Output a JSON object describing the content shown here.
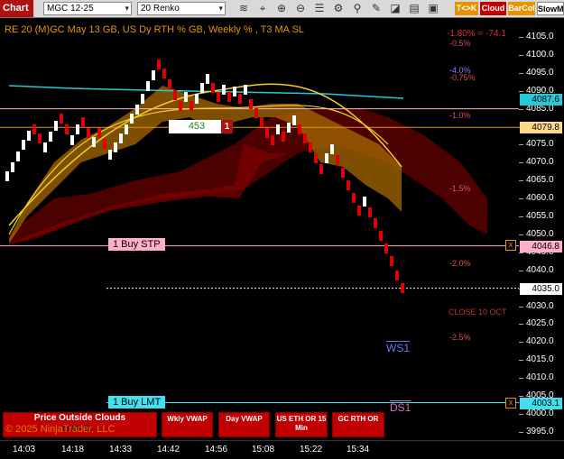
{
  "toolbar": {
    "tab": "Chart",
    "instrument": "MGC 12-25",
    "interval": "20 Renko",
    "buttons": [
      {
        "label": "T<>K",
        "color": "#e59400"
      },
      {
        "label": "Cloud",
        "color": "#c00000"
      },
      {
        "label": "BarCol",
        "color": "#e59400"
      },
      {
        "label": "SlowM",
        "color": "#ffffff"
      }
    ],
    "icons": [
      "bars-icon",
      "crosshair-icon",
      "zoom-in-icon",
      "zoom-out-icon",
      "properties-icon",
      "strategy-icon",
      "indicator-icon",
      "pencil-icon",
      "data-box-icon"
    ]
  },
  "chart": {
    "title": "RE 20  (M)GC May 13 GB, US Dy RTH % GB, Weekly % , T3 MA SL",
    "pnl": "-1.80% = -74.1",
    "bars_label": "453",
    "bars_count": "1",
    "colors": {
      "up": "#ffffff",
      "down": "#e00000",
      "yellow": "#f5d020",
      "orange": "#e59400",
      "cyan": "#28c8d8",
      "pink": "#ff9ec2",
      "dark_red": "#5a0000",
      "buy_lmt": "#40e0f0"
    }
  },
  "pct_labels": [
    {
      "text": "-0.5%",
      "price": 4103.0,
      "color": "#e05050"
    },
    {
      "text": "-4.0%",
      "price": 4095.5,
      "color": "#8080ff"
    },
    {
      "text": "-0.75%",
      "price": 4093.4,
      "color": "#e05050"
    },
    {
      "text": "-1.0%",
      "price": 4083.0,
      "color": "#e05050"
    },
    {
      "text": "-1.5%",
      "price": 4062.5,
      "color": "#e05050"
    },
    {
      "text": "-2.0%",
      "price": 4041.8,
      "color": "#e05050"
    },
    {
      "text": "CLOSE 10 OCT",
      "price": 4028.0,
      "color": "#c03030"
    },
    {
      "text": "-2.5%",
      "price": 4021.0,
      "color": "#e05050"
    }
  ],
  "levels": {
    "ws1": "WS1",
    "ds1": "DS1"
  },
  "orders": {
    "buy_stp": {
      "label": "1 Buy STP",
      "price": 4046.8
    },
    "buy_lmt": {
      "label": "1 Buy LMT",
      "price": 4003.1
    },
    "close_x": "x"
  },
  "price_axis": {
    "ticks": [
      "4105.0",
      "4100.0",
      "4095.0",
      "4090.0",
      "4085.0",
      "4080.0",
      "4075.0",
      "4070.0",
      "4065.0",
      "4060.0",
      "4055.0",
      "4050.0",
      "4045.0",
      "4040.0",
      "4035.0",
      "4030.0",
      "4025.0",
      "4020.0",
      "4015.0",
      "4010.0",
      "4005.0",
      "4000.0",
      "3995.0"
    ],
    "tags": [
      {
        "text": "4087.6",
        "bg": "#28c8d8"
      },
      {
        "text": "4079.8",
        "bg": "#ffd98a"
      },
      {
        "text": "4046.8",
        "bg": "#ffb0c8"
      },
      {
        "text": "4035.0",
        "bg": "#ffffff"
      },
      {
        "text": "4003.1",
        "bg": "#40e0f0"
      }
    ]
  },
  "time_axis": [
    "14:03",
    "14:18",
    "14:33",
    "14:42",
    "14:56",
    "15:08",
    "15:22",
    "15:34"
  ],
  "footer": {
    "price_outside": "Price Outside Clouds",
    "t3": "T3 MA SL",
    "copyright": "© 2025 NinjaTrader, LLC",
    "buttons": [
      "Wkly VWAP",
      "Day VWAP",
      "US ETH OR 15 Min",
      "GC RTH OR"
    ]
  }
}
